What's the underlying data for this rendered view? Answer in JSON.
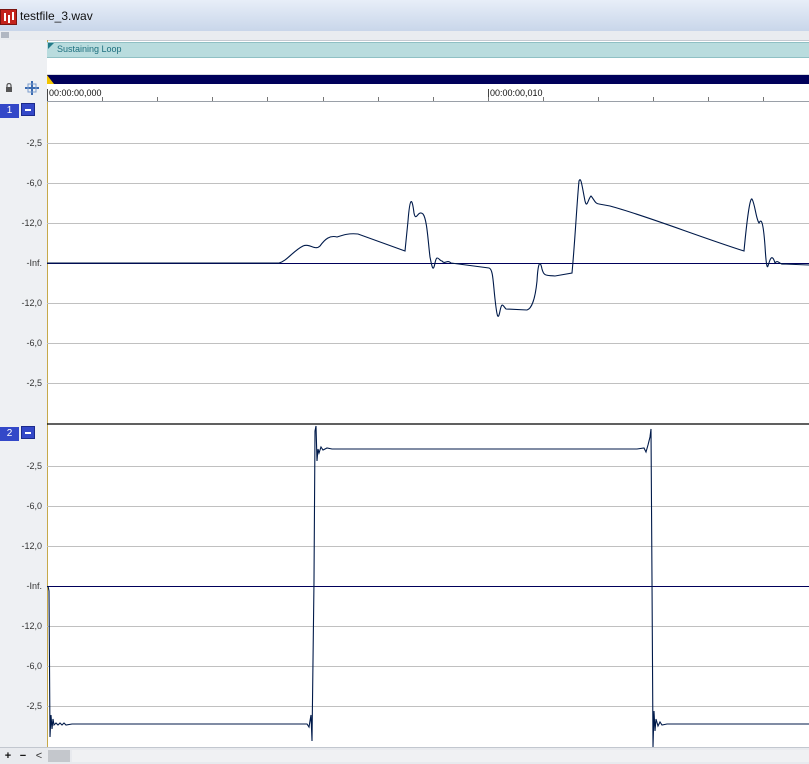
{
  "window": {
    "title": "testfile_3.wav"
  },
  "region": {
    "label": "Sustaining Loop"
  },
  "ruler": {
    "labels": [
      "00:00:00,000",
      "00:00:00,010"
    ]
  },
  "channels": [
    {
      "number": "1",
      "db_labels": [
        "-2,5",
        "-6,0",
        "-12,0",
        "-Inf.",
        "-12,0",
        "-6,0",
        "-2,5"
      ]
    },
    {
      "number": "2",
      "db_labels": [
        "-2,5",
        "-6,0",
        "-12,0",
        "-Inf.",
        "-12,0",
        "-6,0",
        "-2,5"
      ]
    }
  ],
  "icons": {
    "app": "wave-editor-app-icon",
    "lock": "lock-icon",
    "snap": "snap-icon",
    "minimize": "minimize-icon",
    "zoom_in": "plus-icon",
    "zoom_out": "minus-icon",
    "scroll_left": "chevron-left-icon"
  },
  "controls": {
    "zoom_in": "+",
    "zoom_out": "−",
    "scroll_left": "<"
  },
  "colors": {
    "waveform": "#001a4a",
    "center_line": "#00005a",
    "grid": "#c0c0c0",
    "region": "#b9dcde",
    "nav_bar": "#00005a",
    "channel_badge": "#3348c8",
    "cursor": "#f2c400"
  }
}
